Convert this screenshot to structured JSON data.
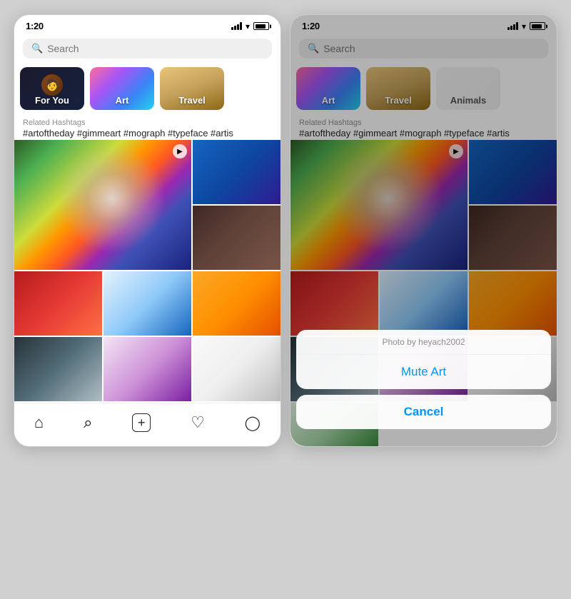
{
  "left_phone": {
    "status": {
      "time": "1:20",
      "signal": true,
      "wifi": true,
      "battery": true
    },
    "search": {
      "placeholder": "Search"
    },
    "categories": [
      {
        "id": "for-you",
        "label": "For You",
        "type": "for-you"
      },
      {
        "id": "art",
        "label": "Art",
        "type": "art"
      },
      {
        "id": "travel",
        "label": "Travel",
        "type": "travel"
      }
    ],
    "related_hashtags": {
      "label": "Related Hashtags",
      "tags": "#artoftheday #gimmeart #mograph #typeface #artis"
    },
    "nav": {
      "items": [
        {
          "id": "home",
          "icon": "⌂",
          "active": false
        },
        {
          "id": "search",
          "icon": "⌕",
          "active": true
        },
        {
          "id": "add",
          "icon": "+",
          "active": false
        },
        {
          "id": "heart",
          "icon": "♡",
          "active": false
        },
        {
          "id": "profile",
          "icon": "◯",
          "active": false
        }
      ]
    }
  },
  "right_phone": {
    "status": {
      "time": "1:20",
      "signal": true,
      "wifi": true,
      "battery": true
    },
    "search": {
      "placeholder": "Search"
    },
    "categories": [
      {
        "id": "art",
        "label": "Art",
        "type": "art"
      },
      {
        "id": "travel",
        "label": "Travel",
        "type": "travel"
      },
      {
        "id": "animals",
        "label": "Animals",
        "type": "animals"
      }
    ],
    "related_hashtags": {
      "label": "Related Hashtags",
      "tags": "#artoftheday #gimmeart #mograph #typeface #artis"
    },
    "action_sheet": {
      "header": "Photo by heyach2002",
      "mute_label": "Mute Art",
      "cancel_label": "Cancel"
    }
  }
}
